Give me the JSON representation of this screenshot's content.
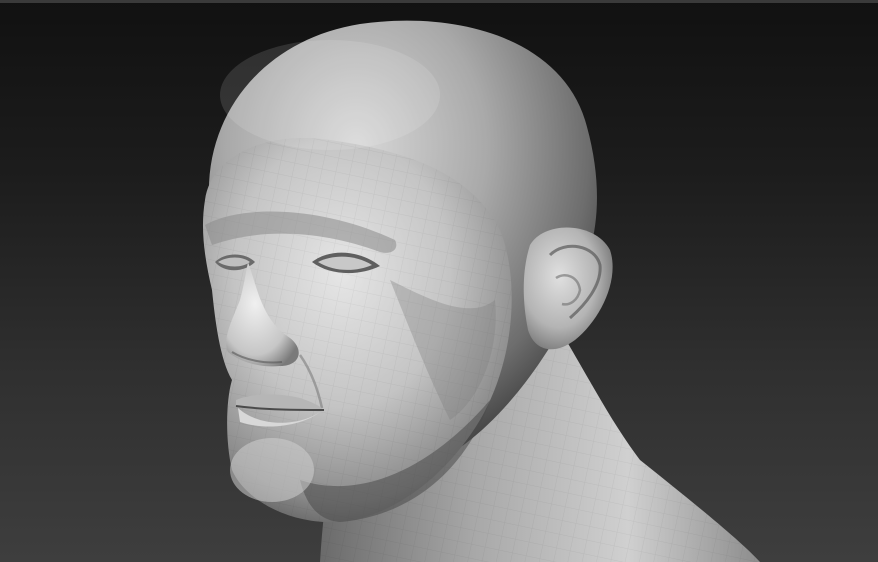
{
  "viewport": {
    "background_top": "#111111",
    "background_bottom": "#3e3e3e",
    "model": "male-head-sculpt",
    "material": "matcap-gray",
    "mesh": "quad-polygroups-visible"
  }
}
